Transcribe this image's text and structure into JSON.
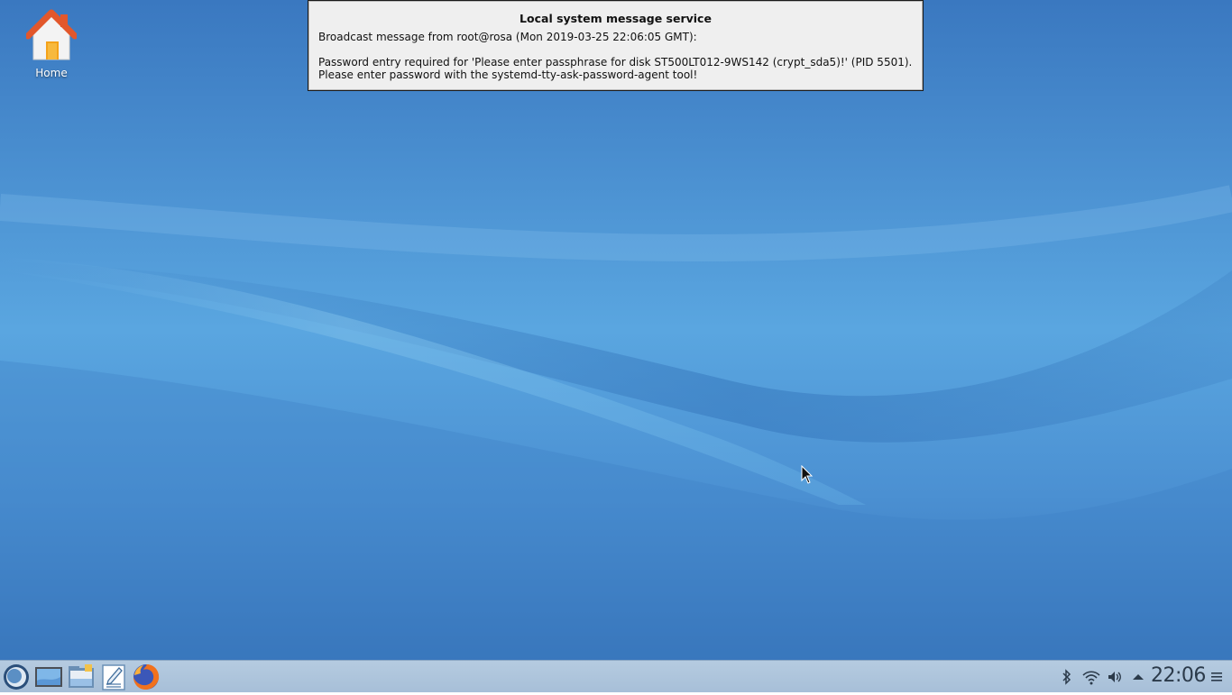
{
  "desktop": {
    "icons": [
      {
        "label": "Home",
        "icon": "home-folder-icon"
      }
    ]
  },
  "message_box": {
    "title": "Local system message service",
    "line1": "Broadcast message from root@rosa (Mon 2019-03-25 22:06:05 GMT):",
    "line2": "Password entry required for 'Please enter passphrase for disk ST500LT012-9WS142 (crypt_sda5)!' (PID 5501).",
    "line3": "Please enter password with the systemd-tty-ask-password-agent tool!"
  },
  "taskbar": {
    "launchers": [
      {
        "name": "application-menu",
        "icon": "rosa-launcher-icon"
      },
      {
        "name": "show-desktop",
        "icon": "desktop-icon"
      },
      {
        "name": "file-manager",
        "icon": "file-manager-icon"
      },
      {
        "name": "text-editor",
        "icon": "text-editor-icon"
      },
      {
        "name": "firefox",
        "icon": "firefox-icon"
      }
    ],
    "tray_icons": [
      "bluetooth-icon",
      "wifi-icon",
      "volume-icon",
      "expand-tray-icon",
      "menu-icon"
    ],
    "clock": "22:06"
  },
  "colors": {
    "desktop_blue": "#4a8fd0",
    "taskbar_bg": "#a7bfd8",
    "dialog_bg": "#efefef"
  }
}
